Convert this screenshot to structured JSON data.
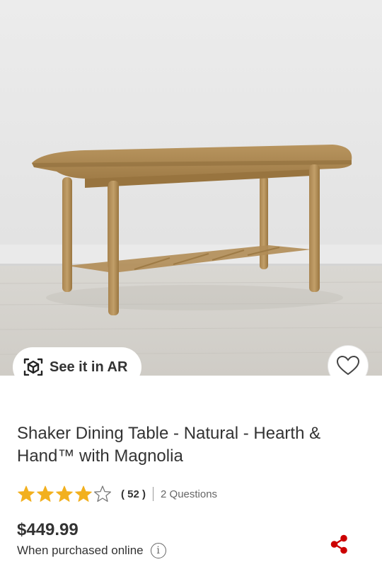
{
  "product": {
    "title": "Shaker Dining Table - Natural - Hearth & Hand™ with Magnolia",
    "rating": 4,
    "rating_max": 5,
    "review_count_text": "( 52 )",
    "questions_text": "2 Questions",
    "price": "$449.99",
    "price_note": "When purchased online"
  },
  "ar": {
    "label": "See it in AR",
    "icon": "ar-cube-icon"
  },
  "icons": {
    "favorite": "heart-icon",
    "share": "share-icon",
    "info": "info-icon",
    "info_glyph": "i"
  },
  "colors": {
    "star": "#F2B01E",
    "share": "#CC0000",
    "text": "#333333",
    "muted": "#666666"
  }
}
